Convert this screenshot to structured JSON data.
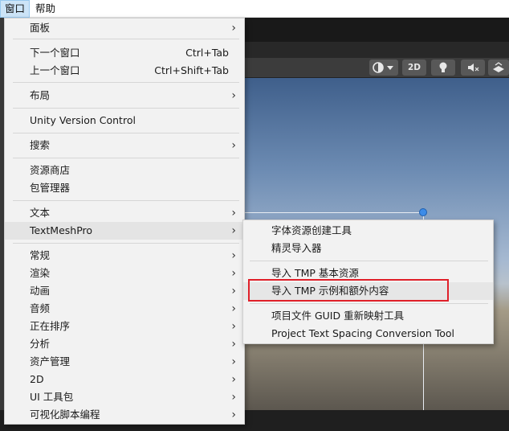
{
  "menubar": {
    "window": "窗口",
    "help": "帮助"
  },
  "toolbar": {
    "btn_2d": "2D"
  },
  "window_menu": {
    "items": [
      {
        "label": "面板",
        "shortcut": "",
        "submenu": true
      },
      {
        "label": "下一个窗口",
        "shortcut": "Ctrl+Tab",
        "submenu": false
      },
      {
        "label": "上一个窗口",
        "shortcut": "Ctrl+Shift+Tab",
        "submenu": false
      },
      {
        "label": "布局",
        "shortcut": "",
        "submenu": true
      },
      {
        "label": "Unity Version Control",
        "shortcut": "",
        "submenu": false
      },
      {
        "label": "搜索",
        "shortcut": "",
        "submenu": true
      },
      {
        "label": "资源商店",
        "shortcut": "",
        "submenu": false
      },
      {
        "label": "包管理器",
        "shortcut": "",
        "submenu": false
      },
      {
        "label": "文本",
        "shortcut": "",
        "submenu": true
      },
      {
        "label": "TextMeshPro",
        "shortcut": "",
        "submenu": true
      },
      {
        "label": "常规",
        "shortcut": "",
        "submenu": true
      },
      {
        "label": "渲染",
        "shortcut": "",
        "submenu": true
      },
      {
        "label": "动画",
        "shortcut": "",
        "submenu": true
      },
      {
        "label": "音频",
        "shortcut": "",
        "submenu": true
      },
      {
        "label": "正在排序",
        "shortcut": "",
        "submenu": true
      },
      {
        "label": "分析",
        "shortcut": "",
        "submenu": true
      },
      {
        "label": "资产管理",
        "shortcut": "",
        "submenu": true
      },
      {
        "label": "2D",
        "shortcut": "",
        "submenu": true
      },
      {
        "label": "UI 工具包",
        "shortcut": "",
        "submenu": true
      },
      {
        "label": "可视化脚本编程",
        "shortcut": "",
        "submenu": true
      }
    ]
  },
  "textmeshpro_submenu": {
    "items": [
      {
        "label": "字体资源创建工具"
      },
      {
        "label": "精灵导入器"
      },
      {
        "label": "导入 TMP 基本资源"
      },
      {
        "label": "导入 TMP 示例和额外内容"
      },
      {
        "label": "项目文件 GUID 重新映射工具"
      },
      {
        "label": "Project Text Spacing Conversion Tool"
      }
    ]
  },
  "colors": {
    "highlight_box": "#e0202a",
    "accent_2d": "#585858"
  },
  "icons": [
    "shading-mode-icon",
    "dropdown-caret-icon",
    "lighting-toggle-icon",
    "audio-mute-icon",
    "effects-icon",
    "submenu-chevron-icon"
  ]
}
